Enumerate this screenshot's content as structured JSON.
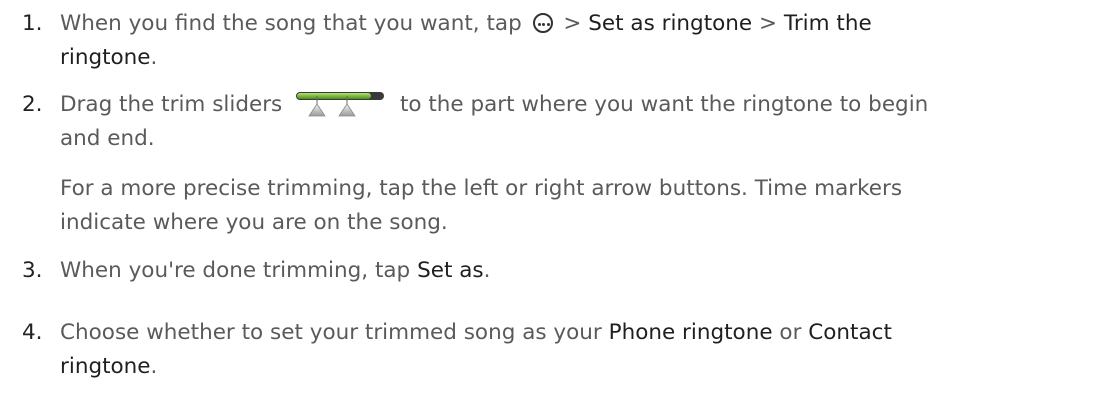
{
  "steps": [
    {
      "number": "1.",
      "line1_text_a": "When you find the song that you want, tap",
      "line1_sep_a": ">",
      "line1_ui_a": "Set as ringtone",
      "line1_sep_b": ">",
      "line1_ui_b": "Trim the",
      "line2_ui": "ringtone",
      "line2_end": "."
    },
    {
      "number": "2.",
      "line1_text_a": "Drag the trim sliders",
      "line1_text_b": "to the part where you want the ringtone to begin",
      "line2_text": "and end.",
      "note_line1": "For a more precise trimming, tap the left or right arrow buttons. Time markers",
      "note_line2": "indicate where you are on the song."
    },
    {
      "number": "3.",
      "text_a": "When you're done trimming, tap",
      "ui_a": "Set as",
      "text_end": "."
    },
    {
      "number": "4.",
      "line1_text_a": "Choose whether to set your trimmed song as your",
      "line1_ui_a": "Phone ringtone",
      "line1_text_b": "or",
      "line1_ui_b": "Contact",
      "line2_ui": "ringtone",
      "line2_end": "."
    }
  ],
  "icons": {
    "more": "more-options-icon",
    "trim": "trim-sliders-icon"
  },
  "colors": {
    "body_text": "#5a5a5a",
    "ui_text": "#1f1f1f",
    "slider_green": "#7dbb3c"
  }
}
